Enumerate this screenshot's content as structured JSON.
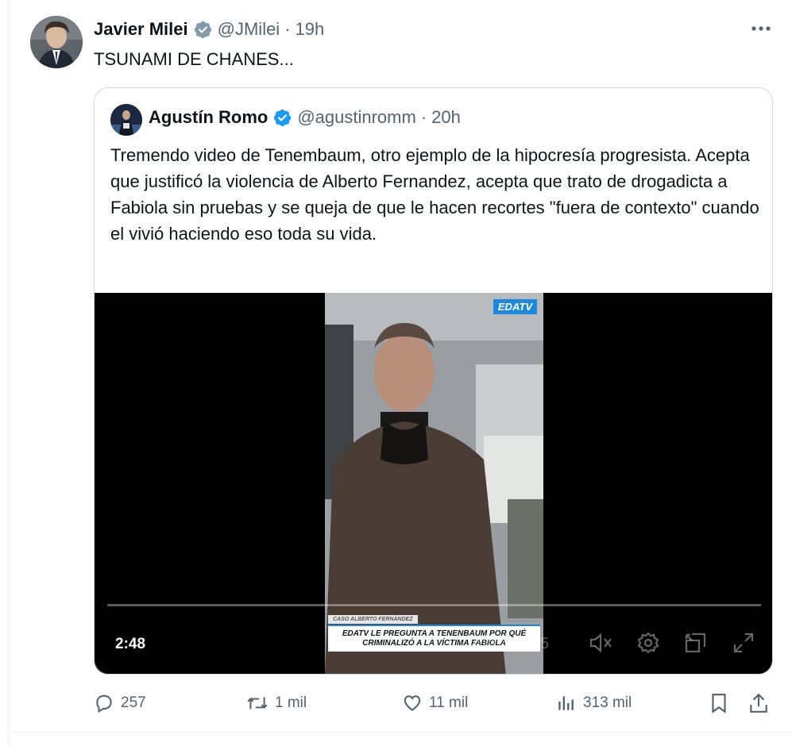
{
  "tweet": {
    "author": {
      "name": "Javier Milei",
      "handle": "@JMilei",
      "time": "19h"
    },
    "text": "TSUNAMI DE CHANES...",
    "quote": {
      "author": {
        "name": "Agustín Romo",
        "handle": "@agustinromm",
        "time": "20h"
      },
      "text": "Tremendo video de Tenembaum, otro ejemplo de la hipocresía progresista. Acepta que justificó la violencia de Alberto Fernandez, acepta que trato de drogadicta a Fabiola sin pruebas y se queja de que le hacen recortes \"fuera de contexto\" cuando el vivió haciendo eso toda su vida.",
      "video": {
        "duration": "2:48",
        "ghost_time": "0:17 / 2:55",
        "logo": "EDATV",
        "chyron_tag": "CASO ALBERTO FERNÁNDEZ",
        "chyron_main": "EDATV LE PREGUNTA A TENENBAUM POR QUÉ CRIMINALIZÓ A LA VÍCTIMA FABIOLA",
        "controls": [
          "mute-icon",
          "settings-icon",
          "pip-icon",
          "fullscreen-icon"
        ]
      }
    },
    "actions": {
      "replies": "257",
      "reposts": "1 mil",
      "likes": "11 mil",
      "views": "313 mil"
    }
  },
  "colors": {
    "verified": "#1d9bf0",
    "secondary_text": "#536471",
    "border": "#cfd9de"
  }
}
